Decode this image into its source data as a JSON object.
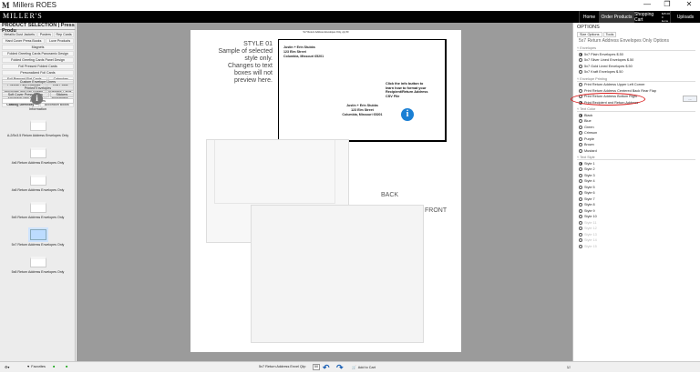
{
  "window": {
    "title": "Millers ROES",
    "logo": "M",
    "controls": [
      "—",
      "❐",
      "✕"
    ]
  },
  "header": {
    "brand": "MILLER'S",
    "nav": [
      {
        "label": "Home"
      },
      {
        "label": "Order Products",
        "active": true
      },
      {
        "label": "Shopping Cart",
        "sub": "$15.00 0 items"
      },
      {
        "label": "Uploads"
      }
    ]
  },
  "left": {
    "title": "PRODUCT SELECTION | Press Produ",
    "products": [
      "Metallic Dust Jackets",
      "Posters",
      "Rep Cards",
      "Hard Cover Press Books",
      "Luxe Products",
      "Magnets",
      "Folded Greeting Cards Panoramic Design",
      "Folded Greeting Cards Panel Design",
      "Foil Pressed Folded Cards",
      "Personalized Foil Cards",
      "Foil Pressed Flat Cards",
      "Calendars",
      "Custom Card Samples",
      "Flat Cards",
      "Brochures and Sell Sheets",
      "Business Cards",
      "Accordion Mini Books",
      "Bookmarks",
      "Catalog Directory",
      "Accordion Books"
    ],
    "tabs": [
      "Custom Envelope Liners",
      "Printed Envelopes",
      "Soft Cover Press Books",
      "Stickers",
      "Envelopes"
    ],
    "active_tab": "Envelopes",
    "info_label": "Information",
    "thumbs": [
      "A-2/5x3.5 Return Address Envelopes Only",
      "4x6 Return Address Envelopes Only",
      "4x8 Return Address Envelopes Only",
      "5x5 Return Address Envelopes Only",
      "5x7 Return Address Envelopes Only",
      "5x8 Return Address Envelopes Only"
    ],
    "selected_thumb": "5x7 Return Address Envelopes Only"
  },
  "preview": {
    "page_title": "5x7 Return Address Envelopes Only, qty 50",
    "style_label": "STYLE 01",
    "style_note": "Sample of selected style only. Changes to text boxes will not preview here.",
    "return_address": [
      "Justin + Erin Stubbs",
      "123 Elm Street",
      "Columbia, Missouri 65201"
    ],
    "recipient_address": [
      "Justin + Erin Stubbs",
      "123 Elm Street",
      "Columbia, Missouri 65201"
    ],
    "back_label": "BACK",
    "front_label": "FRONT",
    "hint": "Click the info button to learn how to format your Recipient/Return Address CSV File"
  },
  "options": {
    "title": "OPTIONS",
    "tabs": [
      "Size Options",
      "Tools"
    ],
    "heading": "5x7 Return Address Envelopes Only Options",
    "sections": [
      {
        "name": "Envelopes",
        "items": [
          "5x7 Plain Envelopes $.50",
          "5x7 Silver Lined Envelopes $.50",
          "5x7 Gold Lined Envelopes $.50",
          "5x7 Kraft Envelopes $.50"
        ],
        "selected": 0
      },
      {
        "name": "Envelope Printing",
        "items": [
          "Print Return Address Upper Left Corner",
          "Print Return Address Centered Back Rear Flap",
          "Print Return Address Bottom Right",
          "Print Recipient and Return Address"
        ],
        "selected": 3
      },
      {
        "name": "Text Color",
        "items": [
          "Black",
          "Blue",
          "Green",
          "Crimson",
          "Purple",
          "Brown",
          "Mustard"
        ],
        "selected": 0
      },
      {
        "name": "Text Style",
        "items": [
          "Style 1",
          "Style 2",
          "Style 3",
          "Style 4",
          "Style 5",
          "Style 6",
          "Style 7",
          "Style 8",
          "Style 9",
          "Style 10",
          "Style 11",
          "Style 12",
          "Style 13",
          "Style 14",
          "Style 15"
        ],
        "selected": 0,
        "disabled_from": 10
      }
    ],
    "csv_button": "...",
    "highlight_color": "#d91a1a"
  },
  "bottom": {
    "favorites": "Favorites",
    "qty_label": "5x7 Return Address Envel Qty:",
    "qty": "50",
    "add_to_cart": "Add to Cart"
  }
}
